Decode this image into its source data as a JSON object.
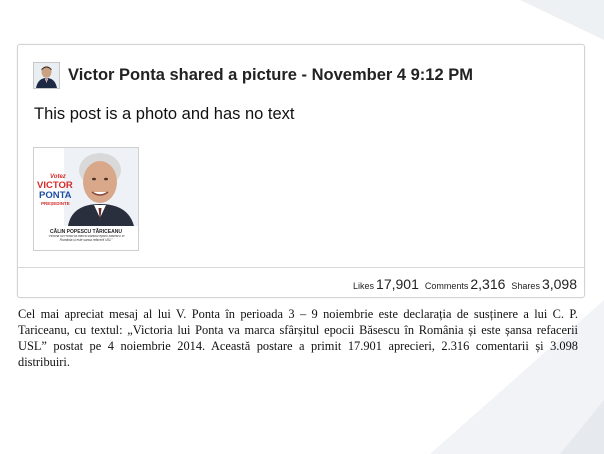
{
  "post": {
    "author": "Victor Ponta",
    "header_text": "Victor Ponta shared a picture - November 4 9:12 PM",
    "body_text": "This post is a photo and has no text",
    "photo": {
      "badge_top": "Votez",
      "badge_name1": "VICTOR",
      "badge_name2": "PONTA",
      "badge_sub": "PREȘEDINTE",
      "person_name": "CĂLIN POPESCU TĂRICEANU",
      "quote": "\"Victoria lui Ponta va marca sfârșitul epocii Băsescu în România și este șansa refacerii USL\""
    },
    "stats": {
      "likes_label": "Likes",
      "likes_value": "17,901",
      "comments_label": "Comments",
      "comments_value": "2,316",
      "shares_label": "Shares",
      "shares_value": "3,098"
    }
  },
  "caption": "Cel mai apreciat mesaj al lui V. Ponta în perioada 3 – 9 noiembrie este declarația de susținere a lui C. P. Tariceanu, cu textul: „Victoria lui Ponta va marca sfârșitul epocii Băsescu în România și este șansa refacerii USL” postat pe 4 noiembrie 2014. Această postare a primit 17.901 aprecieri, 2.316 comentarii și 3.098 distribuiri.",
  "colors": {
    "badge_red": "#d62b2b",
    "badge_blue": "#1f4fa0",
    "card_border": "#d3d3d3"
  }
}
